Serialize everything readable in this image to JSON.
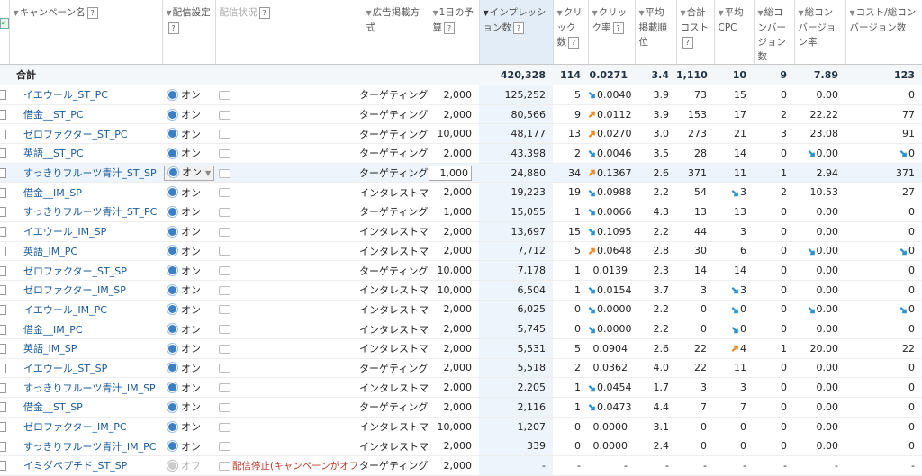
{
  "headers": {
    "campaign": "キャンペーン名",
    "delivery_setting": "配信設定",
    "delivery_status": "配信状況",
    "ad_method": "広告掲載方式",
    "budget": "1日の予算",
    "impressions": "インプレッション数",
    "clicks": "クリック数",
    "ctr": "クリック率",
    "avg_position": "平均掲載順位",
    "total_cost": "合計コスト",
    "avg_cpc": "平均CPC",
    "conversions": "総コンバージョン数",
    "conv_rate": "総コンバージョン率",
    "cost_per_conv": "コスト/総コンバージョン数",
    "help_mark": "?"
  },
  "total": {
    "label": "合計",
    "impressions": "420,328",
    "clicks": "114",
    "ctr": "0.0271",
    "avg_position": "3.4",
    "total_cost": "1,110",
    "avg_cpc": "10",
    "conversions": "9",
    "conv_rate": "7.89",
    "cost_per_conv": "123"
  },
  "arrow_colors": {
    "up": "#f08a24",
    "down": "#2a92d0"
  },
  "rows": [
    {
      "name": "イエウール_ST_PC",
      "status": "オン",
      "delivery": "",
      "method": "ターゲティング",
      "budget": "2,000",
      "impressions": "125,252",
      "clicks": "5",
      "ctr": "0.0040",
      "ctr_arrow": "down",
      "avg_position": "3.9",
      "total_cost": "73",
      "avg_cpc": "15",
      "cpc_arrow": "",
      "conversions": "0",
      "conv_rate": "0.00",
      "rate_arrow": "",
      "cost_per_conv": "0",
      "cpa_arrow": ""
    },
    {
      "name": "借金__ST_PC",
      "status": "オン",
      "delivery": "",
      "method": "ターゲティング",
      "budget": "2,000",
      "impressions": "80,566",
      "clicks": "9",
      "ctr": "0.0112",
      "ctr_arrow": "up",
      "avg_position": "3.9",
      "total_cost": "153",
      "avg_cpc": "17",
      "cpc_arrow": "",
      "conversions": "2",
      "conv_rate": "22.22",
      "rate_arrow": "",
      "cost_per_conv": "77",
      "cpa_arrow": ""
    },
    {
      "name": "ゼロファクター_ST_PC",
      "status": "オン",
      "delivery": "",
      "method": "ターゲティング",
      "budget": "10,000",
      "impressions": "48,177",
      "clicks": "13",
      "ctr": "0.0270",
      "ctr_arrow": "up",
      "avg_position": "3.0",
      "total_cost": "273",
      "avg_cpc": "21",
      "cpc_arrow": "",
      "conversions": "3",
      "conv_rate": "23.08",
      "rate_arrow": "",
      "cost_per_conv": "91",
      "cpa_arrow": ""
    },
    {
      "name": "英語__ST_PC",
      "status": "オン",
      "delivery": "",
      "method": "ターゲティング",
      "budget": "2,000",
      "impressions": "43,398",
      "clicks": "2",
      "ctr": "0.0046",
      "ctr_arrow": "down",
      "avg_position": "3.5",
      "total_cost": "28",
      "avg_cpc": "14",
      "cpc_arrow": "",
      "conversions": "0",
      "conv_rate": "0.00",
      "rate_arrow": "down",
      "cost_per_conv": "0",
      "cpa_arrow": "down"
    },
    {
      "name": "すっきりフルーツ青汁_ST_SP",
      "status": "オン",
      "delivery": "",
      "method": "ターゲティング",
      "budget": "1,000",
      "impressions": "24,880",
      "clicks": "34",
      "ctr": "0.1367",
      "ctr_arrow": "up",
      "avg_position": "2.6",
      "total_cost": "371",
      "avg_cpc": "11",
      "cpc_arrow": "",
      "conversions": "1",
      "conv_rate": "2.94",
      "rate_arrow": "",
      "cost_per_conv": "371",
      "cpa_arrow": "",
      "highlight": true
    },
    {
      "name": "借金__IM_SP",
      "status": "オン",
      "delivery": "",
      "method": "インタレストマッチ",
      "budget": "2,000",
      "impressions": "19,223",
      "clicks": "19",
      "ctr": "0.0988",
      "ctr_arrow": "down",
      "avg_position": "2.2",
      "total_cost": "54",
      "avg_cpc": "3",
      "cpc_arrow": "down",
      "conversions": "2",
      "conv_rate": "10.53",
      "rate_arrow": "",
      "cost_per_conv": "27",
      "cpa_arrow": ""
    },
    {
      "name": "すっきりフルーツ青汁_ST_PC",
      "status": "オン",
      "delivery": "",
      "method": "ターゲティング",
      "budget": "1,000",
      "impressions": "15,055",
      "clicks": "1",
      "ctr": "0.0066",
      "ctr_arrow": "down",
      "avg_position": "4.3",
      "total_cost": "13",
      "avg_cpc": "13",
      "cpc_arrow": "",
      "conversions": "0",
      "conv_rate": "0.00",
      "rate_arrow": "",
      "cost_per_conv": "0",
      "cpa_arrow": ""
    },
    {
      "name": "イエウール_IM_SP",
      "status": "オン",
      "delivery": "",
      "method": "インタレストマッチ",
      "budget": "2,000",
      "impressions": "13,697",
      "clicks": "15",
      "ctr": "0.1095",
      "ctr_arrow": "down",
      "avg_position": "2.2",
      "total_cost": "44",
      "avg_cpc": "3",
      "cpc_arrow": "",
      "conversions": "0",
      "conv_rate": "0.00",
      "rate_arrow": "",
      "cost_per_conv": "0",
      "cpa_arrow": ""
    },
    {
      "name": "英語_IM_PC",
      "status": "オン",
      "delivery": "",
      "method": "インタレストマッチ",
      "budget": "2,000",
      "impressions": "7,712",
      "clicks": "5",
      "ctr": "0.0648",
      "ctr_arrow": "up",
      "avg_position": "2.8",
      "total_cost": "30",
      "avg_cpc": "6",
      "cpc_arrow": "",
      "conversions": "0",
      "conv_rate": "0.00",
      "rate_arrow": "down",
      "cost_per_conv": "0",
      "cpa_arrow": "down"
    },
    {
      "name": "ゼロファクター_ST_SP",
      "status": "オン",
      "delivery": "",
      "method": "ターゲティング",
      "budget": "10,000",
      "impressions": "7,178",
      "clicks": "1",
      "ctr": "0.0139",
      "ctr_arrow": "",
      "avg_position": "2.3",
      "total_cost": "14",
      "avg_cpc": "14",
      "cpc_arrow": "",
      "conversions": "0",
      "conv_rate": "0.00",
      "rate_arrow": "",
      "cost_per_conv": "0",
      "cpa_arrow": ""
    },
    {
      "name": "ゼロファクター_IM_SP",
      "status": "オン",
      "delivery": "",
      "method": "インタレストマッチ",
      "budget": "10,000",
      "impressions": "6,504",
      "clicks": "1",
      "ctr": "0.0154",
      "ctr_arrow": "down",
      "avg_position": "3.7",
      "total_cost": "3",
      "avg_cpc": "3",
      "cpc_arrow": "down",
      "conversions": "0",
      "conv_rate": "0.00",
      "rate_arrow": "",
      "cost_per_conv": "0",
      "cpa_arrow": ""
    },
    {
      "name": "イエウール_IM_PC",
      "status": "オン",
      "delivery": "",
      "method": "インタレストマッチ",
      "budget": "2,000",
      "impressions": "6,025",
      "clicks": "0",
      "ctr": "0.0000",
      "ctr_arrow": "down",
      "avg_position": "2.2",
      "total_cost": "0",
      "avg_cpc": "0",
      "cpc_arrow": "down",
      "conversions": "0",
      "conv_rate": "0.00",
      "rate_arrow": "down",
      "cost_per_conv": "0",
      "cpa_arrow": "down"
    },
    {
      "name": "借金__IM_PC",
      "status": "オン",
      "delivery": "",
      "method": "インタレストマッチ",
      "budget": "2,000",
      "impressions": "5,745",
      "clicks": "0",
      "ctr": "0.0000",
      "ctr_arrow": "down",
      "avg_position": "2.2",
      "total_cost": "0",
      "avg_cpc": "0",
      "cpc_arrow": "down",
      "conversions": "0",
      "conv_rate": "0.00",
      "rate_arrow": "",
      "cost_per_conv": "0",
      "cpa_arrow": ""
    },
    {
      "name": "英語_IM_SP",
      "status": "オン",
      "delivery": "",
      "method": "インタレストマッチ",
      "budget": "2,000",
      "impressions": "5,531",
      "clicks": "5",
      "ctr": "0.0904",
      "ctr_arrow": "",
      "avg_position": "2.6",
      "total_cost": "22",
      "avg_cpc": "4",
      "cpc_arrow": "up",
      "conversions": "1",
      "conv_rate": "20.00",
      "rate_arrow": "",
      "cost_per_conv": "22",
      "cpa_arrow": ""
    },
    {
      "name": "イエウール_ST_SP",
      "status": "オン",
      "delivery": "",
      "method": "ターゲティング",
      "budget": "2,000",
      "impressions": "5,518",
      "clicks": "2",
      "ctr": "0.0362",
      "ctr_arrow": "",
      "avg_position": "4.0",
      "total_cost": "22",
      "avg_cpc": "11",
      "cpc_arrow": "",
      "conversions": "0",
      "conv_rate": "0.00",
      "rate_arrow": "",
      "cost_per_conv": "0",
      "cpa_arrow": ""
    },
    {
      "name": "すっきりフルーツ青汁_IM_SP",
      "status": "オン",
      "delivery": "",
      "method": "インタレストマッチ",
      "budget": "2,000",
      "impressions": "2,205",
      "clicks": "1",
      "ctr": "0.0454",
      "ctr_arrow": "down",
      "avg_position": "1.7",
      "total_cost": "3",
      "avg_cpc": "3",
      "cpc_arrow": "",
      "conversions": "0",
      "conv_rate": "0.00",
      "rate_arrow": "",
      "cost_per_conv": "0",
      "cpa_arrow": ""
    },
    {
      "name": "借金__ST_SP",
      "status": "オン",
      "delivery": "",
      "method": "ターゲティング",
      "budget": "2,000",
      "impressions": "2,116",
      "clicks": "1",
      "ctr": "0.0473",
      "ctr_arrow": "down",
      "avg_position": "4.4",
      "total_cost": "7",
      "avg_cpc": "7",
      "cpc_arrow": "",
      "conversions": "0",
      "conv_rate": "0.00",
      "rate_arrow": "",
      "cost_per_conv": "0",
      "cpa_arrow": ""
    },
    {
      "name": "ゼロファクター_IM_PC",
      "status": "オン",
      "delivery": "",
      "method": "インタレストマッチ",
      "budget": "10,000",
      "impressions": "1,207",
      "clicks": "0",
      "ctr": "0.0000",
      "ctr_arrow": "",
      "avg_position": "3.1",
      "total_cost": "0",
      "avg_cpc": "0",
      "cpc_arrow": "",
      "conversions": "0",
      "conv_rate": "0.00",
      "rate_arrow": "",
      "cost_per_conv": "0",
      "cpa_arrow": ""
    },
    {
      "name": "すっきりフルーツ青汁_IM_PC",
      "status": "オン",
      "delivery": "",
      "method": "インタレストマッチ",
      "budget": "2,000",
      "impressions": "339",
      "clicks": "0",
      "ctr": "0.0000",
      "ctr_arrow": "",
      "avg_position": "2.4",
      "total_cost": "0",
      "avg_cpc": "0",
      "cpc_arrow": "",
      "conversions": "0",
      "conv_rate": "0.00",
      "rate_arrow": "",
      "cost_per_conv": "0",
      "cpa_arrow": ""
    },
    {
      "name": "イミダペプチド_ST_SP",
      "status": "オフ",
      "delivery": "配信停止(キャンペーンがオフ)",
      "method": "ターゲティング",
      "budget": "2,000",
      "impressions": "-",
      "clicks": "-",
      "ctr": "-",
      "ctr_arrow": "",
      "avg_position": "-",
      "total_cost": "-",
      "avg_cpc": "-",
      "cpc_arrow": "",
      "conversions": "-",
      "conv_rate": "-",
      "rate_arrow": "",
      "cost_per_conv": "-",
      "cpa_arrow": "",
      "off": true
    }
  ]
}
